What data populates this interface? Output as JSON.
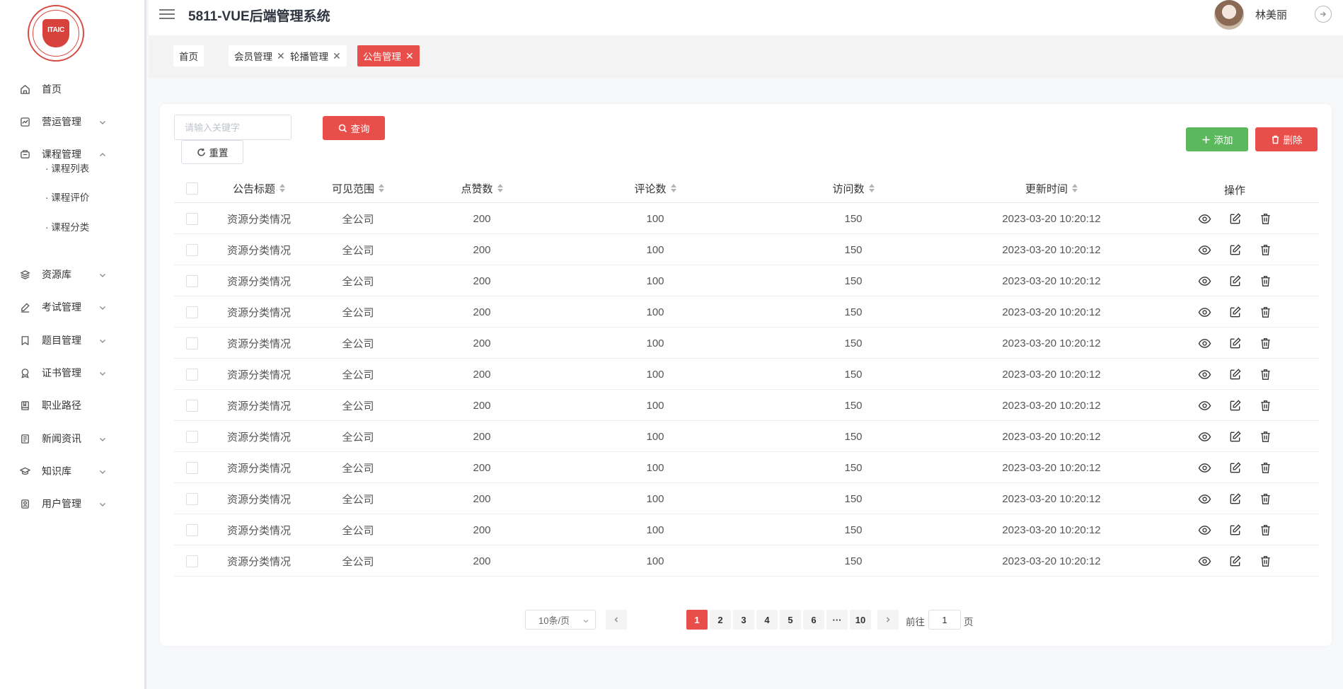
{
  "app": {
    "title": "5811-VUE后端管理系统",
    "user_name": "林美丽",
    "logo_text": "ITAIC"
  },
  "sidebar": {
    "items": [
      {
        "label": "首页",
        "icon": "home-icon",
        "expandable": false
      },
      {
        "label": "营运管理",
        "icon": "chart-icon",
        "expandable": true
      },
      {
        "label": "课程管理",
        "icon": "course-icon",
        "expandable": true,
        "expanded": true
      },
      {
        "label": "资源库",
        "icon": "layers-icon",
        "expandable": true
      },
      {
        "label": "考试管理",
        "icon": "pen-icon",
        "expandable": true
      },
      {
        "label": "题目管理",
        "icon": "bookmark-icon",
        "expandable": true
      },
      {
        "label": "证书管理",
        "icon": "medal-icon",
        "expandable": true
      },
      {
        "label": "职业路径",
        "icon": "book-icon",
        "expandable": false
      },
      {
        "label": "新闻资讯",
        "icon": "news-icon",
        "expandable": true
      },
      {
        "label": "知识库",
        "icon": "graduation-icon",
        "expandable": true
      },
      {
        "label": "用户管理",
        "icon": "user-card-icon",
        "expandable": true
      }
    ],
    "sub_items": [
      "· 课程列表",
      "· 课程评价",
      "· 课程分类"
    ]
  },
  "tags": [
    {
      "label": "首页",
      "closable": false,
      "active": false
    },
    {
      "label": "会员管理",
      "closable": true,
      "active": false
    },
    {
      "label": "轮播管理",
      "closable": true,
      "active": false
    },
    {
      "label": "公告管理",
      "closable": true,
      "active": true
    }
  ],
  "toolbar": {
    "search_placeholder": "请输入关键字",
    "query_label": "查询",
    "reset_label": "重置",
    "add_label": "添加",
    "delete_label": "删除"
  },
  "table": {
    "headers": [
      "公告标题",
      "可见范围",
      "点赞数",
      "评论数",
      "访问数",
      "更新时间",
      "操作"
    ],
    "rows": [
      {
        "title": "资源分类情况",
        "scope": "全公司",
        "likes": "200",
        "comments": "100",
        "visits": "150",
        "updated": "2023-03-20 10:20:12"
      },
      {
        "title": "资源分类情况",
        "scope": "全公司",
        "likes": "200",
        "comments": "100",
        "visits": "150",
        "updated": "2023-03-20 10:20:12"
      },
      {
        "title": "资源分类情况",
        "scope": "全公司",
        "likes": "200",
        "comments": "100",
        "visits": "150",
        "updated": "2023-03-20 10:20:12"
      },
      {
        "title": "资源分类情况",
        "scope": "全公司",
        "likes": "200",
        "comments": "100",
        "visits": "150",
        "updated": "2023-03-20 10:20:12"
      },
      {
        "title": "资源分类情况",
        "scope": "全公司",
        "likes": "200",
        "comments": "100",
        "visits": "150",
        "updated": "2023-03-20 10:20:12"
      },
      {
        "title": "资源分类情况",
        "scope": "全公司",
        "likes": "200",
        "comments": "100",
        "visits": "150",
        "updated": "2023-03-20 10:20:12"
      },
      {
        "title": "资源分类情况",
        "scope": "全公司",
        "likes": "200",
        "comments": "100",
        "visits": "150",
        "updated": "2023-03-20 10:20:12"
      },
      {
        "title": "资源分类情况",
        "scope": "全公司",
        "likes": "200",
        "comments": "100",
        "visits": "150",
        "updated": "2023-03-20 10:20:12"
      },
      {
        "title": "资源分类情况",
        "scope": "全公司",
        "likes": "200",
        "comments": "100",
        "visits": "150",
        "updated": "2023-03-20 10:20:12"
      },
      {
        "title": "资源分类情况",
        "scope": "全公司",
        "likes": "200",
        "comments": "100",
        "visits": "150",
        "updated": "2023-03-20 10:20:12"
      },
      {
        "title": "资源分类情况",
        "scope": "全公司",
        "likes": "200",
        "comments": "100",
        "visits": "150",
        "updated": "2023-03-20 10:20:12"
      },
      {
        "title": "资源分类情况",
        "scope": "全公司",
        "likes": "200",
        "comments": "100",
        "visits": "150",
        "updated": "2023-03-20 10:20:12"
      }
    ]
  },
  "pagination": {
    "page_size_label": "10条/页",
    "pages": [
      "1",
      "2",
      "3",
      "4",
      "5",
      "6",
      "···",
      "10"
    ],
    "current": "1",
    "goto_label": "前往",
    "goto_value": "1",
    "goto_unit": "页"
  },
  "colors": {
    "accent": "#e84e4a",
    "success": "#5cb85c"
  }
}
